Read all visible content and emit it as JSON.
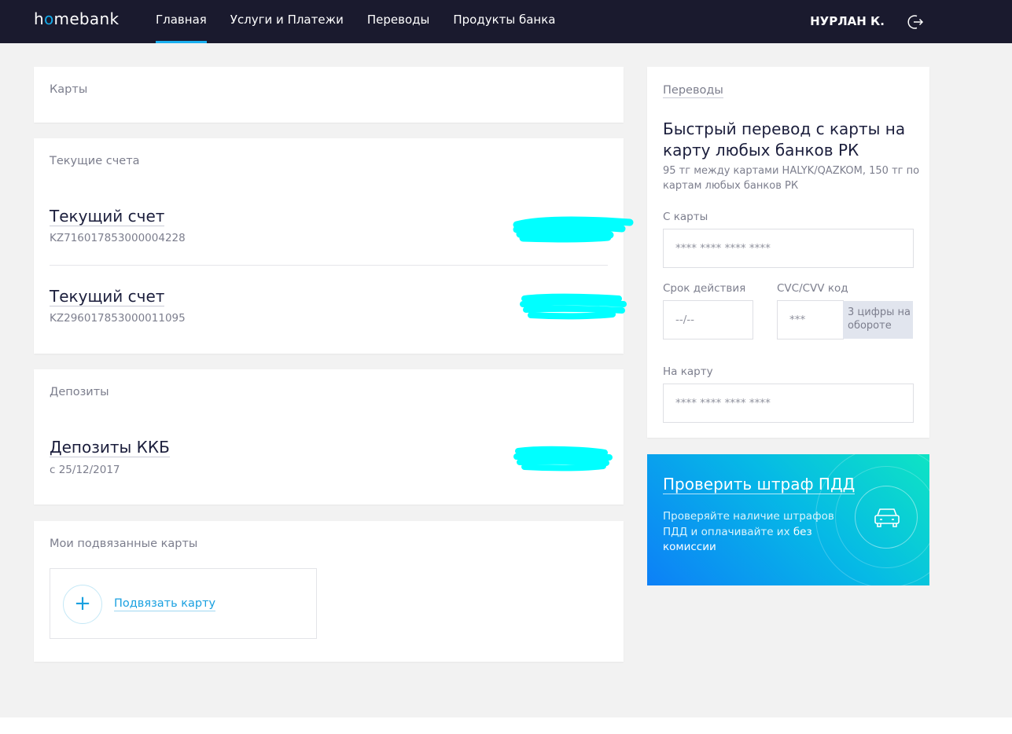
{
  "header": {
    "logo_prefix": "h",
    "logo_o": "o",
    "logo_suffix": "mebank",
    "nav": [
      "Главная",
      "Услуги и Платежи",
      "Переводы",
      "Продукты банка"
    ],
    "user_name": "НУРЛАН К.",
    "logout_icon": "logout-icon"
  },
  "cards_section": {
    "title": "Карты"
  },
  "accounts_section": {
    "title": "Текущие счета",
    "items": [
      {
        "name": "Текущий счет",
        "number": "KZ716017853000004228"
      },
      {
        "name": "Текущий счет",
        "number": "KZ296017853000011095"
      }
    ]
  },
  "deposits_section": {
    "title": "Депозиты",
    "item": {
      "name": "Депозиты ККБ",
      "since": "с 25/12/2017"
    }
  },
  "linked_cards": {
    "title": "Мои подвязанные карты",
    "add_label": "Подвязать карту"
  },
  "transfer": {
    "title": "Переводы",
    "heading": "Быстрый перевод с карты на карту любых банков РК",
    "description": "95 тг между картами HALYK/QAZKOM, 150 тг по картам любых банков РК",
    "from_label": "С карты",
    "from_placeholder": "**** **** **** ****",
    "expiry_label": "Срок действия",
    "expiry_placeholder": "--/--",
    "cvc_label": "CVC/CVV код",
    "cvc_placeholder": "***",
    "cvc_hint": "3 цифры на обороте",
    "to_label": "На карту",
    "to_placeholder": "**** **** **** ****"
  },
  "fine_banner": {
    "title": "Проверить штраф ПДД",
    "desc_part1": "Проверяйте наличие штрафов ПДД и оплачивайте их ",
    "desc_bold": "без комиссии",
    "icon": "car-icon"
  },
  "colors": {
    "header_bg": "#1a1a2e",
    "accent": "#1aa0e0",
    "redaction": "#00ffff",
    "banner_start": "#0d80f7",
    "banner_end": "#0ee4c4"
  }
}
